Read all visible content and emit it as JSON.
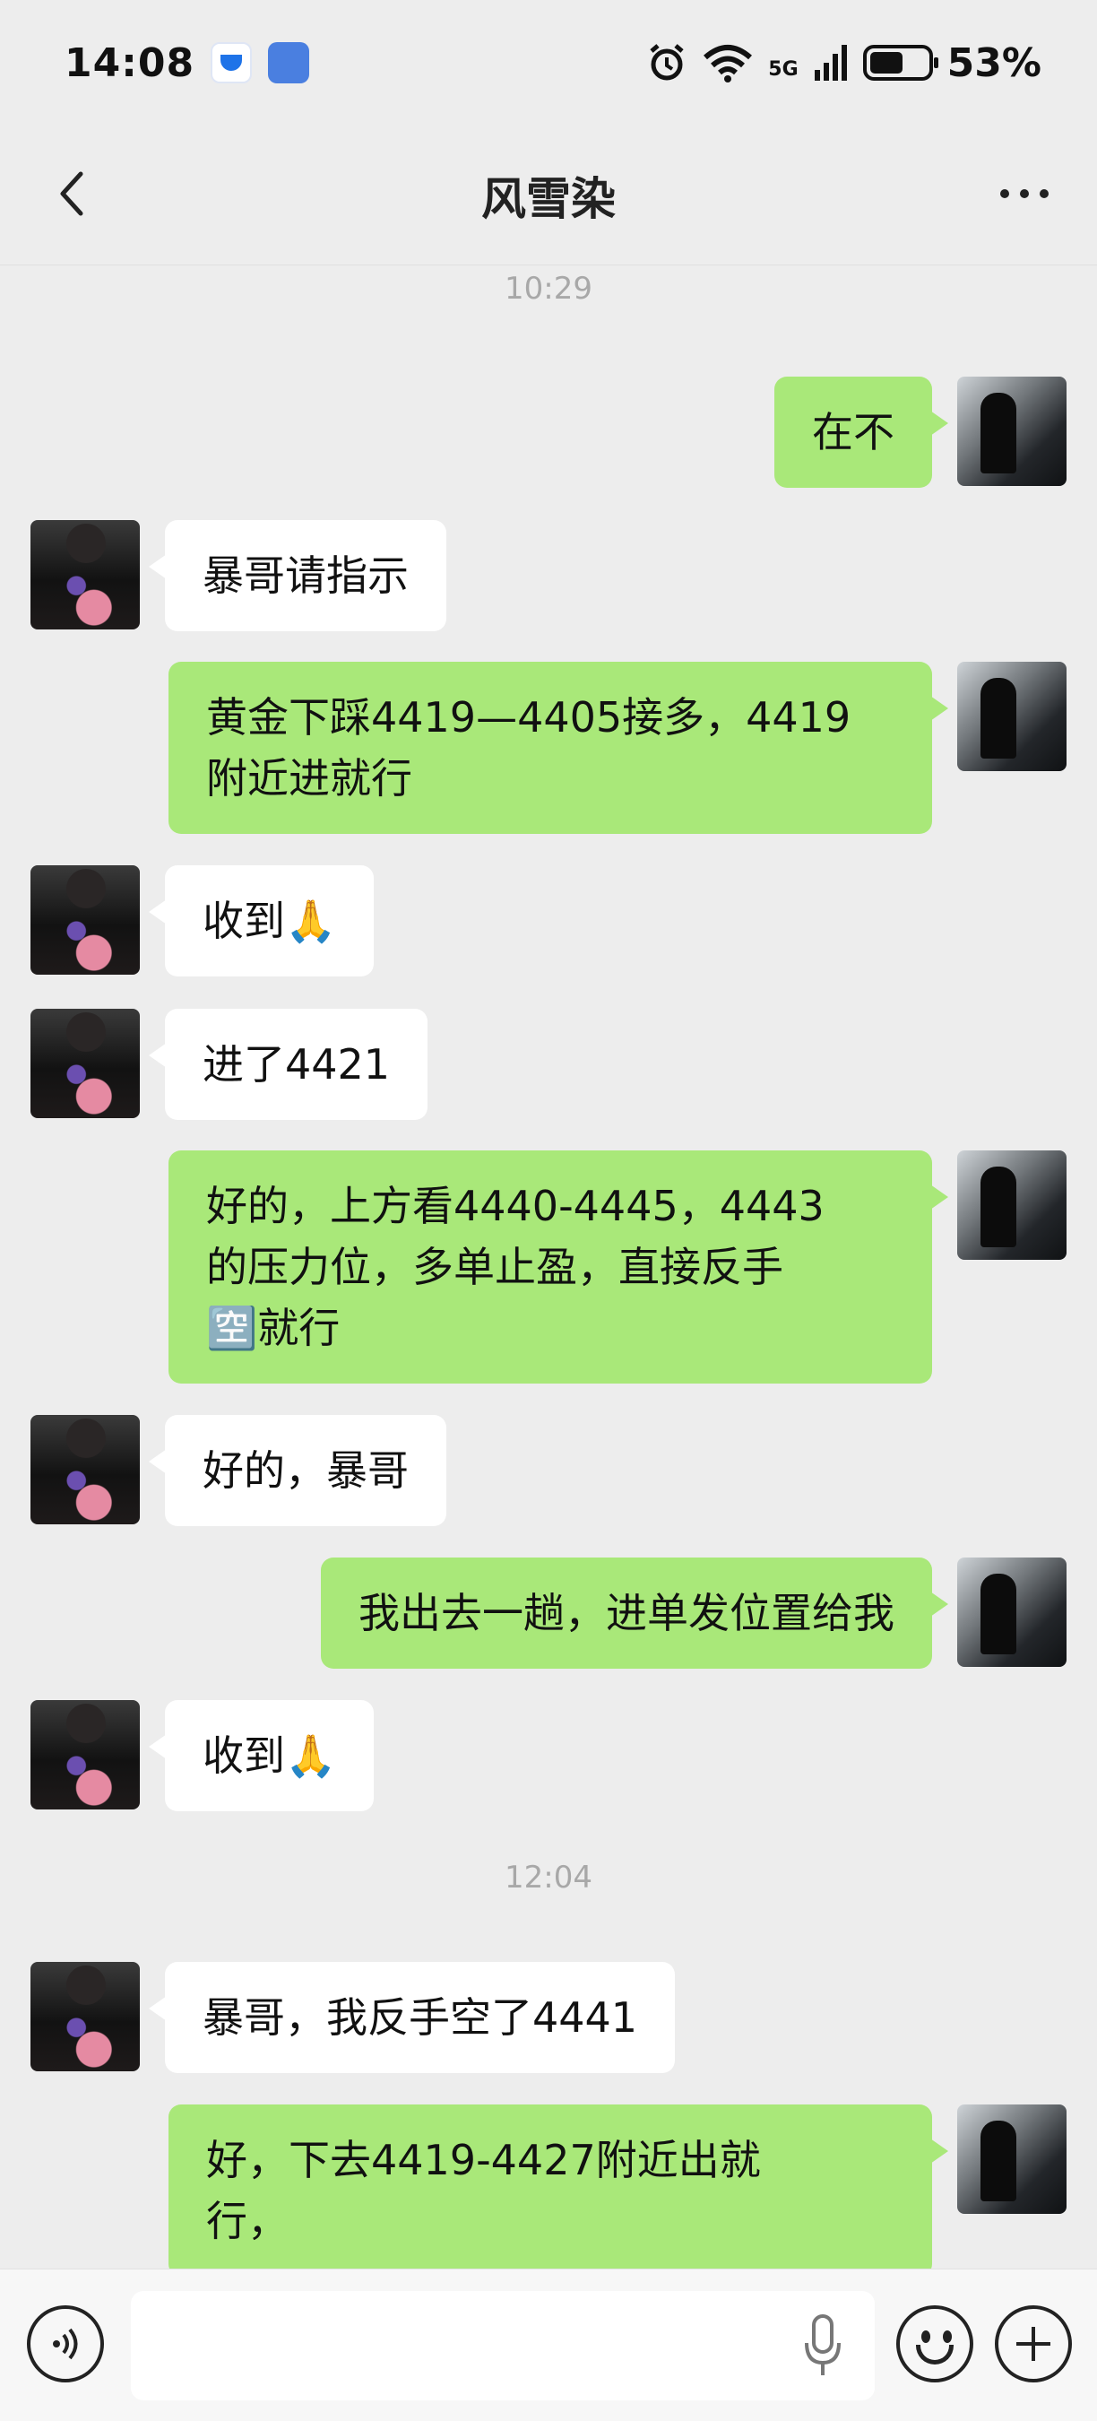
{
  "status_bar": {
    "time": "14:08",
    "network": "5G",
    "battery": "53%"
  },
  "header": {
    "title": "风雪染"
  },
  "chat": {
    "timestamps": [
      "10:29",
      "12:04"
    ],
    "messages": [
      {
        "from": "me",
        "text": "在不"
      },
      {
        "from": "other",
        "text": "暴哥请指示"
      },
      {
        "from": "me",
        "text": "黄金下踩4419—4405接多，4419\n附近进就行"
      },
      {
        "from": "other",
        "text": "收到🙏"
      },
      {
        "from": "other",
        "text": "进了4421"
      },
      {
        "from": "me",
        "text": "好的，上方看4440-4445，4443\n的压力位，多单止盈，直接反手\n🈳就行"
      },
      {
        "from": "other",
        "text": "好的，暴哥"
      },
      {
        "from": "me",
        "text": "我出去一趟，进单发位置给我"
      },
      {
        "from": "other",
        "text": "收到🙏"
      },
      {
        "from": "other",
        "text": "暴哥，我反手空了4441"
      },
      {
        "from": "me",
        "text": "好，下去4419-4427附近出就\n行，"
      }
    ]
  }
}
